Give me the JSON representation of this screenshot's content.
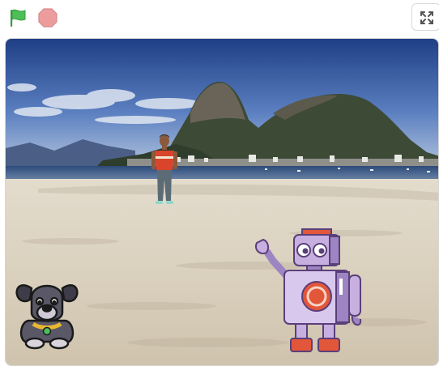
{
  "controls": {
    "green_flag_icon": "green-flag-icon",
    "stop_icon": "stop-sign-icon",
    "fullscreen_icon": "fullscreen-icon",
    "colors": {
      "flag": "#4cbf56",
      "stop": "#ec9c9c",
      "stop_border": "#d88a8a"
    }
  },
  "stage": {
    "backdrop": "beach-rio",
    "sprites": [
      "person",
      "dog",
      "robot"
    ]
  }
}
